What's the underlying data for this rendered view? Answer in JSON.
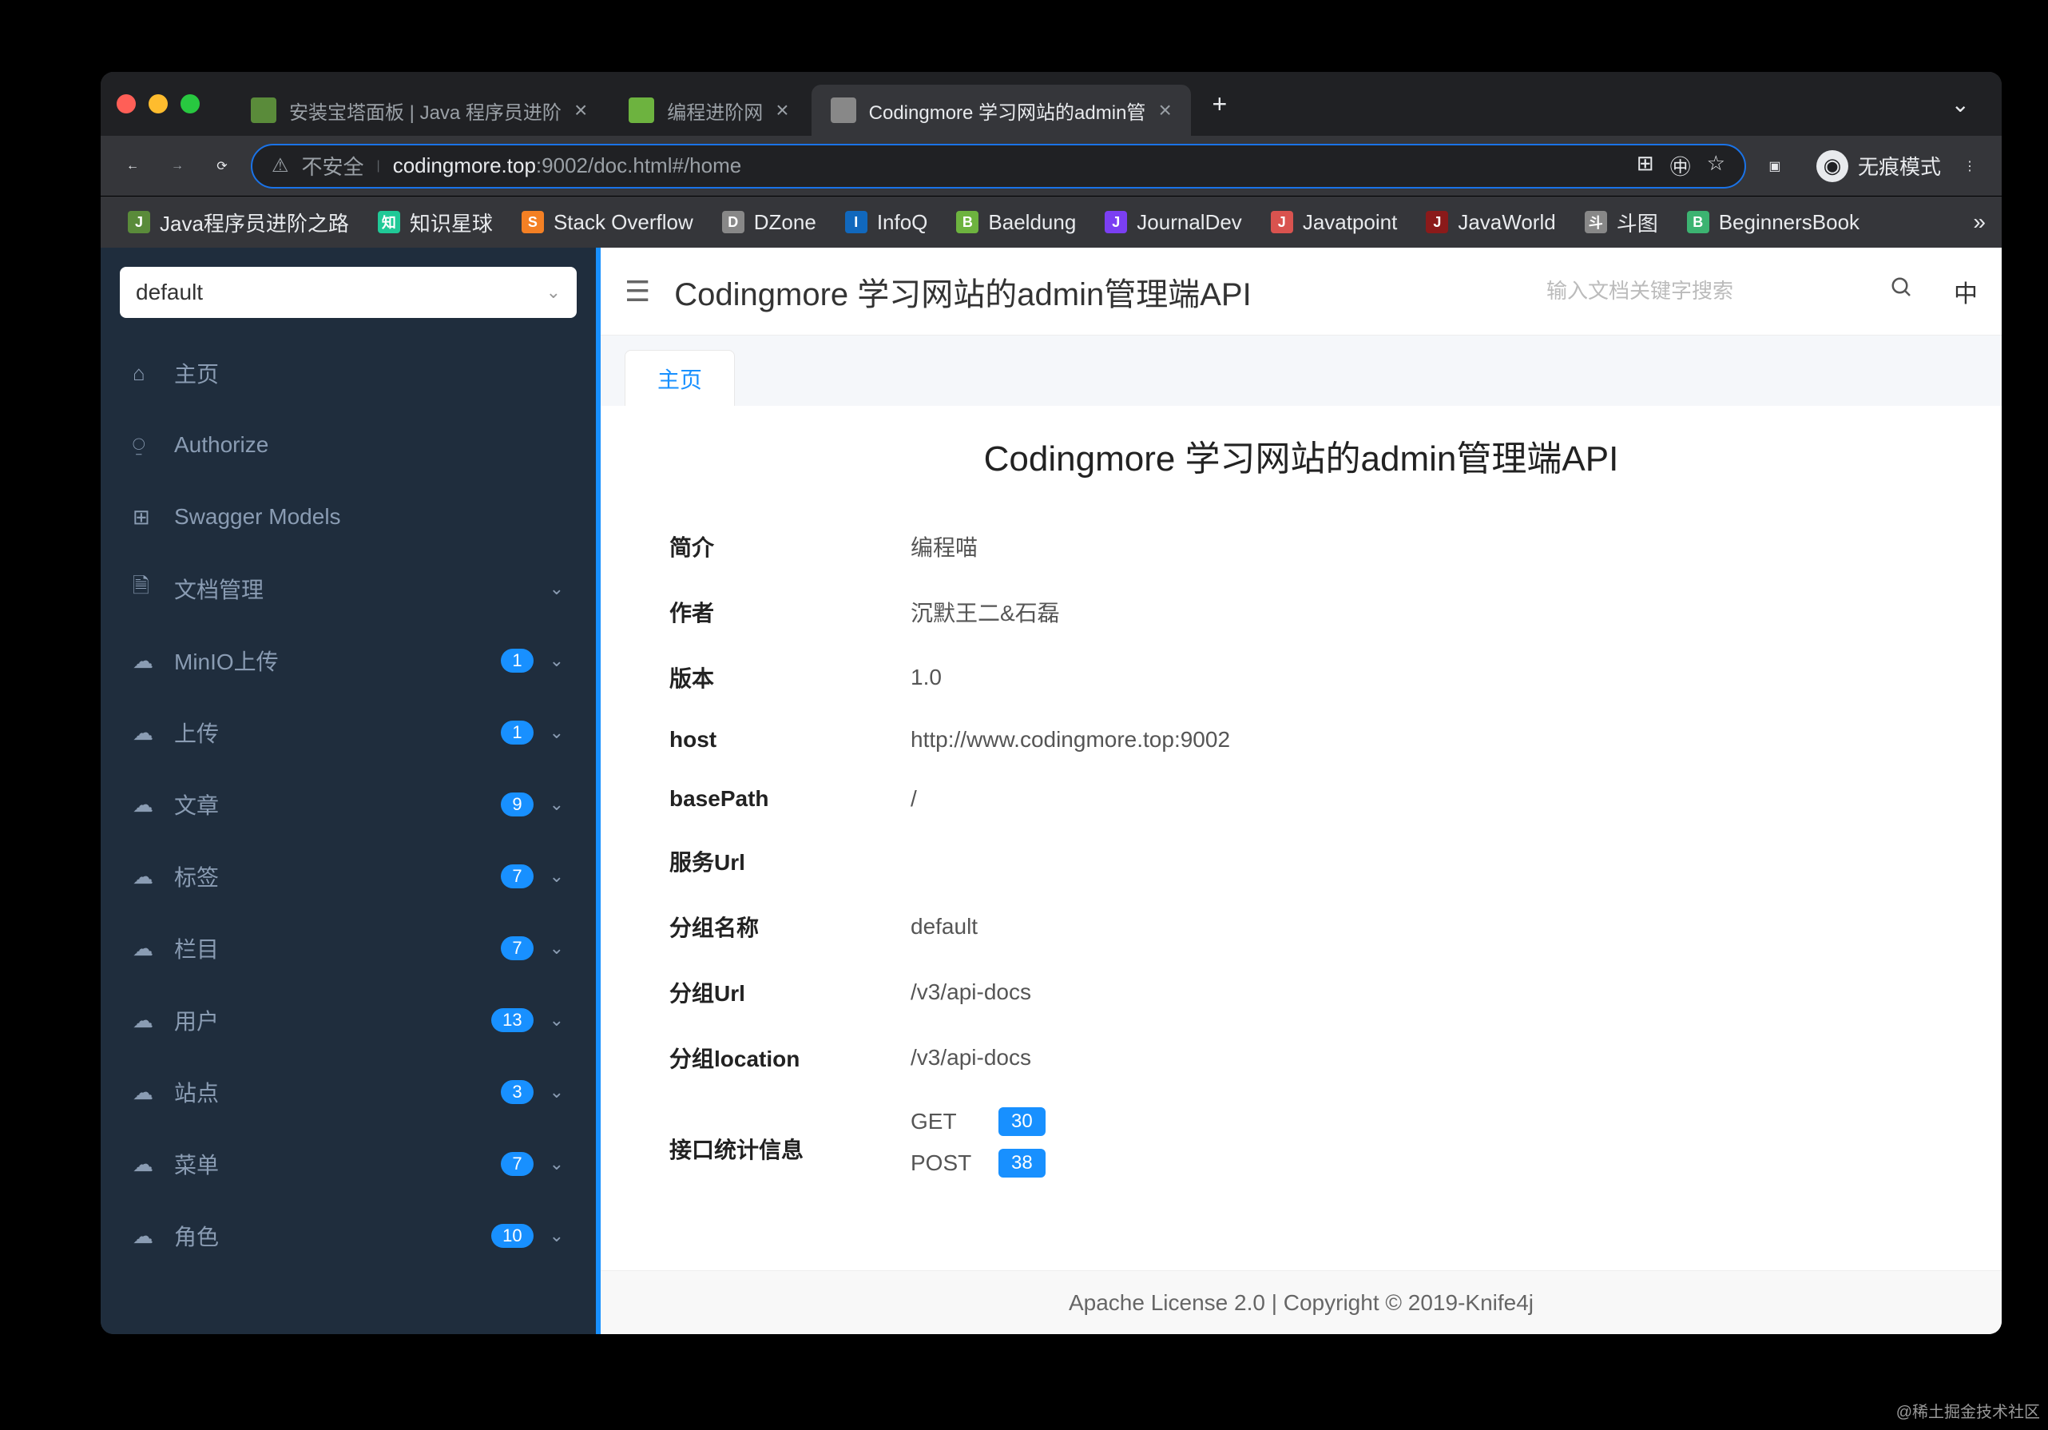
{
  "watermark": "@稀土掘金技术社区",
  "browser": {
    "tabs": [
      {
        "title": "安装宝塔面板 | Java 程序员进阶",
        "active": false
      },
      {
        "title": "编程进阶网",
        "active": false
      },
      {
        "title": "Codingmore 学习网站的admin管",
        "active": true
      }
    ],
    "url_insecure_label": "不安全",
    "url_host": "codingmore.top",
    "url_port": ":9002",
    "url_path": "/doc.html#/home",
    "incognito_label": "无痕模式",
    "bookmarks": [
      {
        "label": "Java程序员进阶之路",
        "color": "#5a8b3a"
      },
      {
        "label": "知识星球",
        "color": "#20c997"
      },
      {
        "label": "Stack Overflow",
        "color": "#f48024"
      },
      {
        "label": "DZone",
        "color": "#888"
      },
      {
        "label": "InfoQ",
        "color": "#1168bd"
      },
      {
        "label": "Baeldung",
        "color": "#6db33f"
      },
      {
        "label": "JournalDev",
        "color": "#7b3ff2"
      },
      {
        "label": "Javatpoint",
        "color": "#d9534f"
      },
      {
        "label": "JavaWorld",
        "color": "#8b1a1a"
      },
      {
        "label": "斗图",
        "color": "#888"
      },
      {
        "label": "BeginnersBook",
        "color": "#3cb371"
      }
    ]
  },
  "sidebar": {
    "select_value": "default",
    "items": [
      {
        "icon": "⌂",
        "label": "主页",
        "badge": null,
        "chevron": false
      },
      {
        "icon": "⍜",
        "label": "Authorize",
        "badge": null,
        "chevron": false
      },
      {
        "icon": "⊞",
        "label": "Swagger Models",
        "badge": null,
        "chevron": false
      },
      {
        "icon": "🗎",
        "label": "文档管理",
        "badge": null,
        "chevron": true
      },
      {
        "icon": "☁",
        "label": "MinIO上传",
        "badge": "1",
        "chevron": true
      },
      {
        "icon": "☁",
        "label": "上传",
        "badge": "1",
        "chevron": true
      },
      {
        "icon": "☁",
        "label": "文章",
        "badge": "9",
        "chevron": true
      },
      {
        "icon": "☁",
        "label": "标签",
        "badge": "7",
        "chevron": true
      },
      {
        "icon": "☁",
        "label": "栏目",
        "badge": "7",
        "chevron": true
      },
      {
        "icon": "☁",
        "label": "用户",
        "badge": "13",
        "chevron": true
      },
      {
        "icon": "☁",
        "label": "站点",
        "badge": "3",
        "chevron": true
      },
      {
        "icon": "☁",
        "label": "菜单",
        "badge": "7",
        "chevron": true
      },
      {
        "icon": "☁",
        "label": "角色",
        "badge": "10",
        "chevron": true
      }
    ]
  },
  "main": {
    "header_title": "Codingmore 学习网站的admin管理端API",
    "search_placeholder": "输入文档关键字搜索",
    "lang": "中",
    "tab_label": "主页",
    "page_title": "Codingmore 学习网站的admin管理端API",
    "rows": [
      {
        "k": "简介",
        "v": "编程喵"
      },
      {
        "k": "作者",
        "v": "沉默王二&石磊"
      },
      {
        "k": "版本",
        "v": "1.0"
      },
      {
        "k": "host",
        "v": "http://www.codingmore.top:9002"
      },
      {
        "k": "basePath",
        "v": "/"
      },
      {
        "k": "服务Url",
        "v": ""
      },
      {
        "k": "分组名称",
        "v": "default"
      },
      {
        "k": "分组Url",
        "v": "/v3/api-docs"
      },
      {
        "k": "分组location",
        "v": "/v3/api-docs"
      }
    ],
    "stats_label": "接口统计信息",
    "stats": [
      {
        "method": "GET",
        "count": "30"
      },
      {
        "method": "POST",
        "count": "38"
      }
    ],
    "footer": "Apache License 2.0 | Copyright © 2019-Knife4j"
  }
}
